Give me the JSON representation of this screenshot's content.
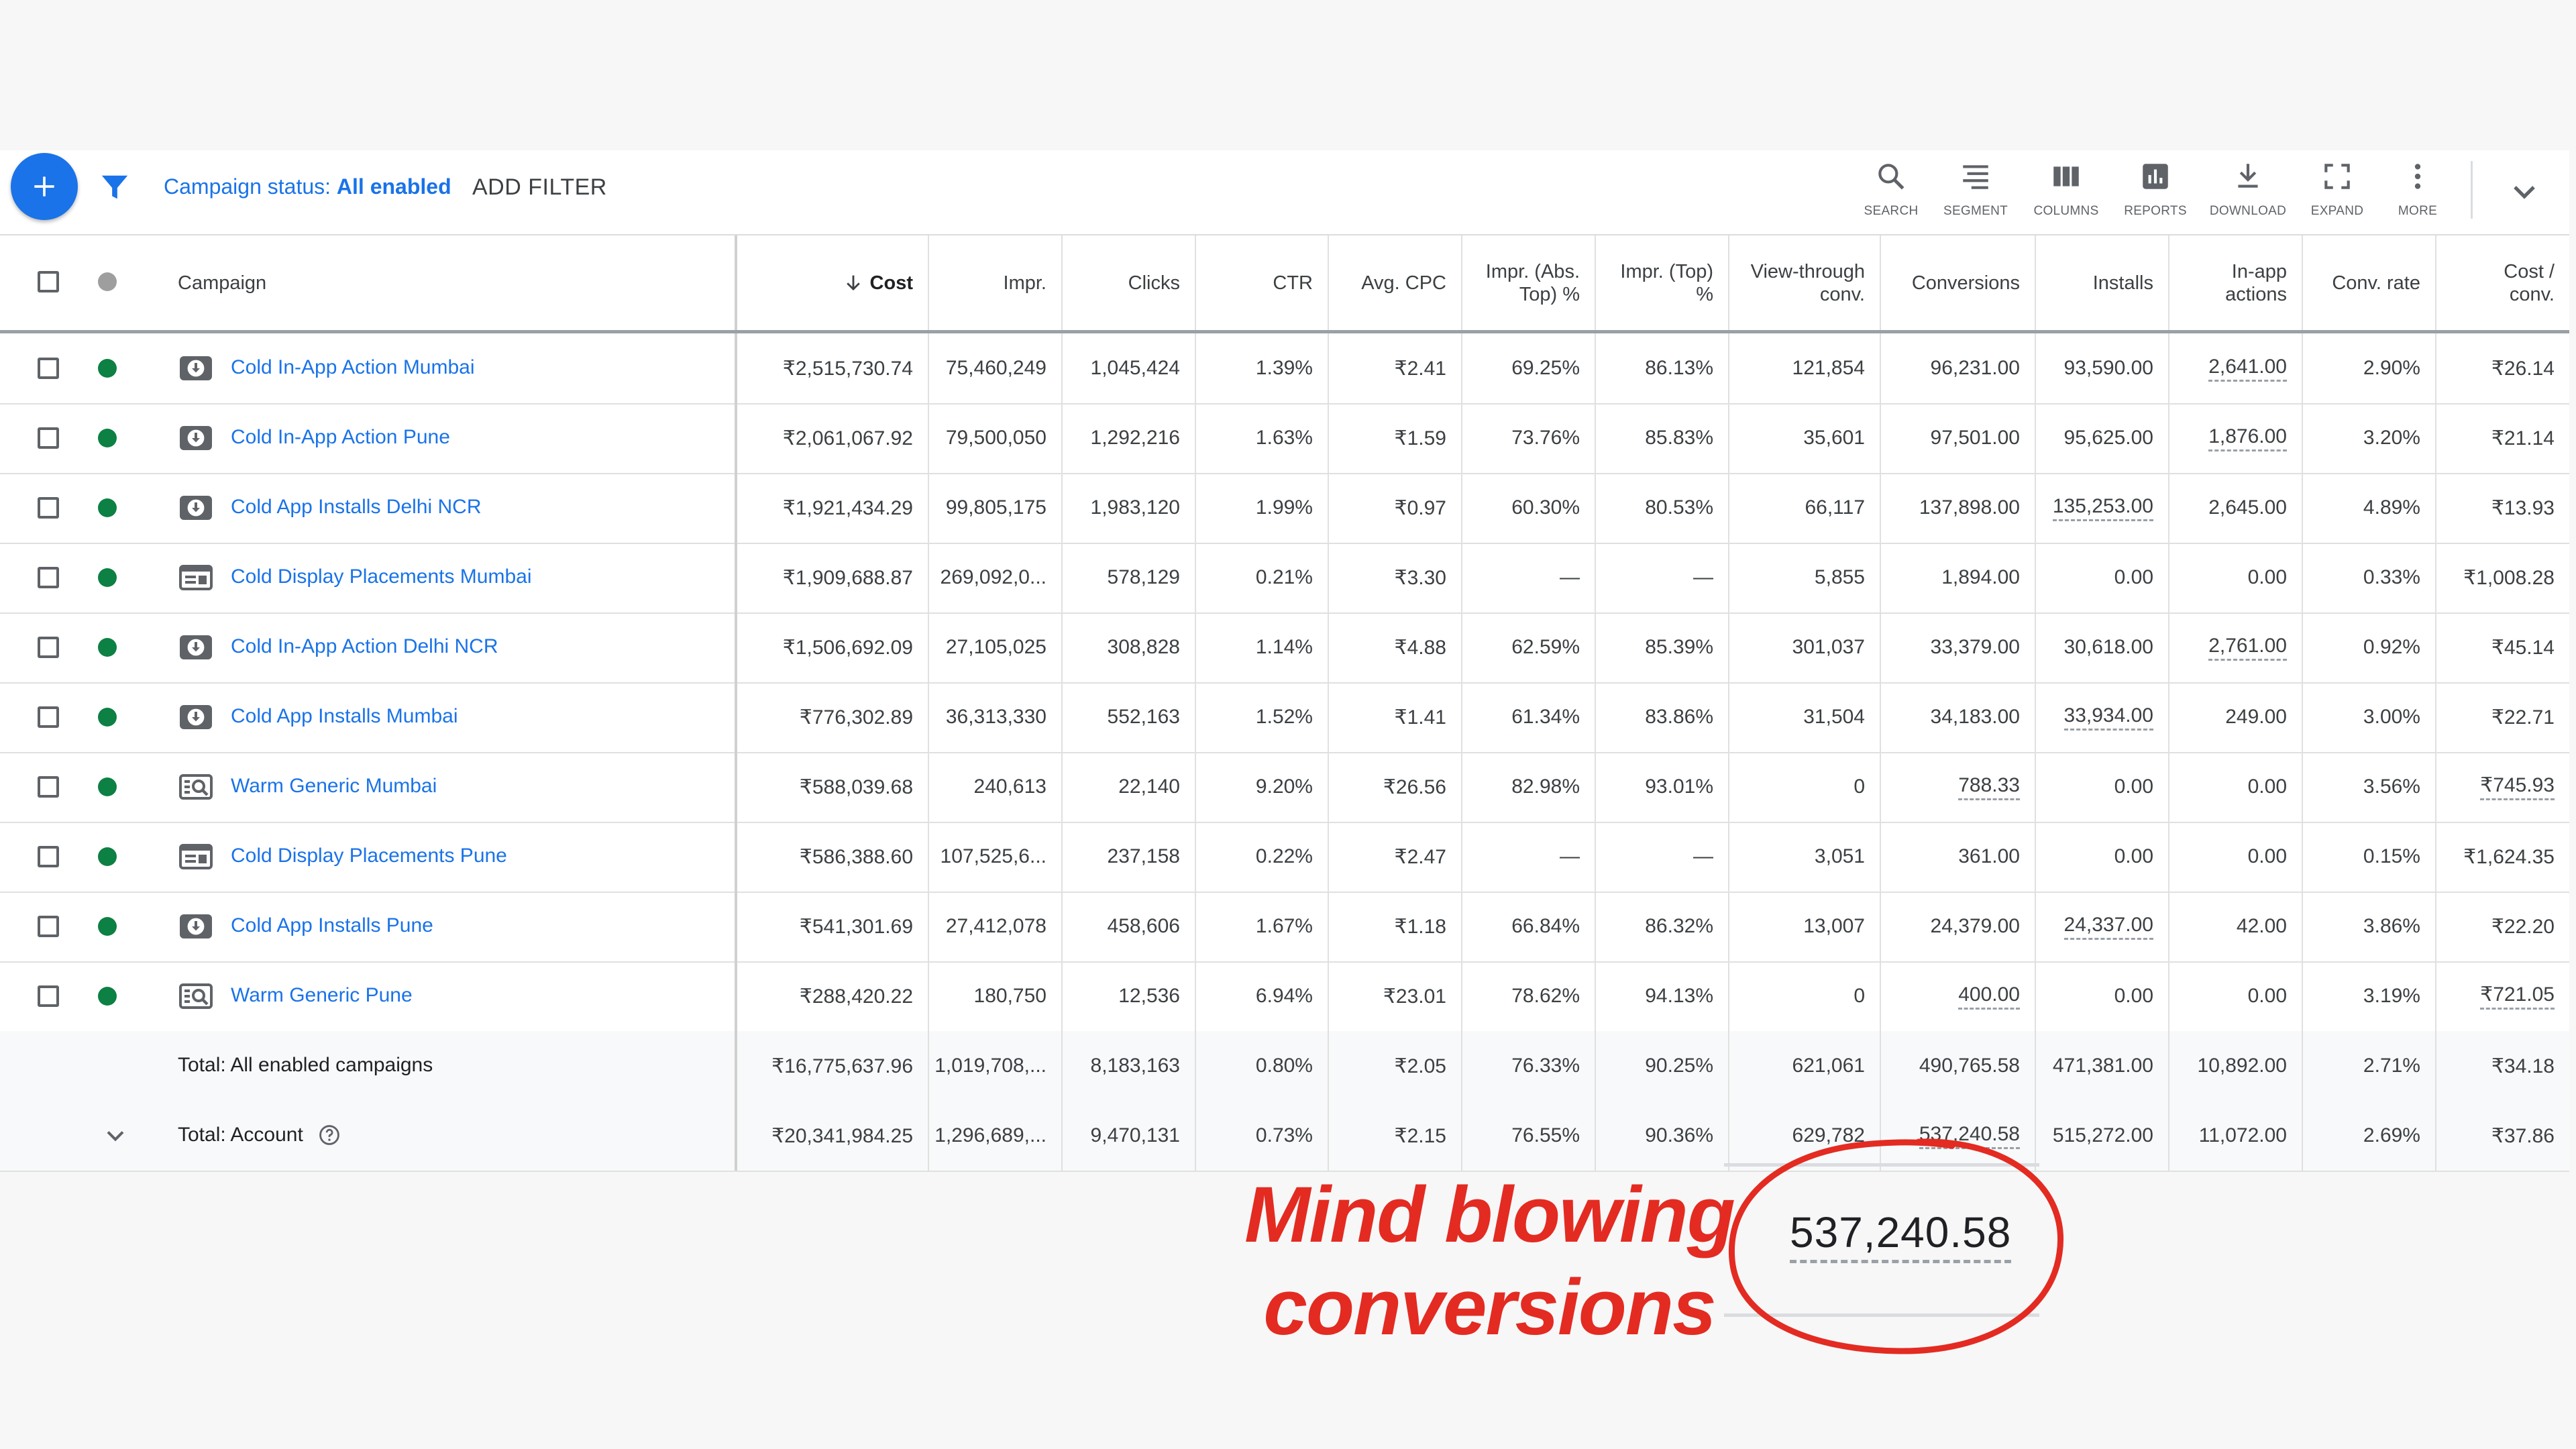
{
  "toolbar": {
    "filter_label": "Campaign status:",
    "filter_value": "All enabled",
    "add_filter": "ADD FILTER",
    "tools": [
      {
        "label": "SEARCH",
        "icon": "search-icon"
      },
      {
        "label": "SEGMENT",
        "icon": "segment-icon"
      },
      {
        "label": "COLUMNS",
        "icon": "columns-icon"
      },
      {
        "label": "REPORTS",
        "icon": "reports-icon"
      },
      {
        "label": "DOWNLOAD",
        "icon": "download-icon"
      },
      {
        "label": "EXPAND",
        "icon": "expand-icon"
      },
      {
        "label": "MORE",
        "icon": "more-vert-icon"
      }
    ]
  },
  "columns": {
    "campaign": "Campaign",
    "cost": "Cost",
    "impr": "Impr.",
    "clicks": "Clicks",
    "ctr": "CTR",
    "avg_cpc": "Avg. CPC",
    "impr_abs_top_1": "Impr. (Abs.",
    "impr_abs_top_2": "Top) %",
    "impr_top_1": "Impr. (Top)",
    "impr_top_2": "%",
    "view_through_1": "View-through",
    "view_through_2": "conv.",
    "conversions": "Conversions",
    "installs": "Installs",
    "inapp_1": "In-app",
    "inapp_2": "actions",
    "conv_rate": "Conv. rate",
    "cost_conv_1": "Cost /",
    "cost_conv_2": "conv."
  },
  "rows": [
    {
      "campaign": "Cold In-App Action Mumbai",
      "type": "app",
      "cost": "₹2,515,730.74",
      "impr": "75,460,249",
      "clicks": "1,045,424",
      "ctr": "1.39%",
      "avg_cpc": "₹2.41",
      "abs_top": "69.25%",
      "top": "86.13%",
      "view_through": "121,854",
      "conversions": "96,231.00",
      "installs": "93,590.00",
      "inapp": "2,641.00",
      "conv_rate": "2.90%",
      "cost_conv": "₹26.14"
    },
    {
      "campaign": "Cold In-App Action Pune",
      "type": "app",
      "cost": "₹2,061,067.92",
      "impr": "79,500,050",
      "clicks": "1,292,216",
      "ctr": "1.63%",
      "avg_cpc": "₹1.59",
      "abs_top": "73.76%",
      "top": "85.83%",
      "view_through": "35,601",
      "conversions": "97,501.00",
      "installs": "95,625.00",
      "inapp": "1,876.00",
      "conv_rate": "3.20%",
      "cost_conv": "₹21.14"
    },
    {
      "campaign": "Cold App Installs Delhi NCR",
      "type": "app",
      "cost": "₹1,921,434.29",
      "impr": "99,805,175",
      "clicks": "1,983,120",
      "ctr": "1.99%",
      "avg_cpc": "₹0.97",
      "abs_top": "60.30%",
      "top": "80.53%",
      "view_through": "66,117",
      "conversions": "137,898.00",
      "installs": "135,253.00",
      "inapp": "2,645.00",
      "conv_rate": "4.89%",
      "cost_conv": "₹13.93"
    },
    {
      "campaign": "Cold Display Placements Mumbai",
      "type": "display",
      "cost": "₹1,909,688.87",
      "impr": "269,092,0...",
      "clicks": "578,129",
      "ctr": "0.21%",
      "avg_cpc": "₹3.30",
      "abs_top": "—",
      "top": "—",
      "view_through": "5,855",
      "conversions": "1,894.00",
      "installs": "0.00",
      "inapp": "0.00",
      "conv_rate": "0.33%",
      "cost_conv": "₹1,008.28"
    },
    {
      "campaign": "Cold In-App Action Delhi NCR",
      "type": "app",
      "cost": "₹1,506,692.09",
      "impr": "27,105,025",
      "clicks": "308,828",
      "ctr": "1.14%",
      "avg_cpc": "₹4.88",
      "abs_top": "62.59%",
      "top": "85.39%",
      "view_through": "301,037",
      "conversions": "33,379.00",
      "installs": "30,618.00",
      "inapp": "2,761.00",
      "conv_rate": "0.92%",
      "cost_conv": "₹45.14"
    },
    {
      "campaign": "Cold App Installs Mumbai",
      "type": "app",
      "cost": "₹776,302.89",
      "impr": "36,313,330",
      "clicks": "552,163",
      "ctr": "1.52%",
      "avg_cpc": "₹1.41",
      "abs_top": "61.34%",
      "top": "83.86%",
      "view_through": "31,504",
      "conversions": "34,183.00",
      "installs": "33,934.00",
      "inapp": "249.00",
      "conv_rate": "3.00%",
      "cost_conv": "₹22.71"
    },
    {
      "campaign": "Warm Generic Mumbai",
      "type": "search",
      "cost": "₹588,039.68",
      "impr": "240,613",
      "clicks": "22,140",
      "ctr": "9.20%",
      "avg_cpc": "₹26.56",
      "abs_top": "82.98%",
      "top": "93.01%",
      "view_through": "0",
      "conversions": "788.33",
      "installs": "0.00",
      "inapp": "0.00",
      "conv_rate": "3.56%",
      "cost_conv": "₹745.93"
    },
    {
      "campaign": "Cold Display Placements Pune",
      "type": "display",
      "cost": "₹586,388.60",
      "impr": "107,525,6...",
      "clicks": "237,158",
      "ctr": "0.22%",
      "avg_cpc": "₹2.47",
      "abs_top": "—",
      "top": "—",
      "view_through": "3,051",
      "conversions": "361.00",
      "installs": "0.00",
      "inapp": "0.00",
      "conv_rate": "0.15%",
      "cost_conv": "₹1,624.35"
    },
    {
      "campaign": "Cold App Installs Pune",
      "type": "app",
      "cost": "₹541,301.69",
      "impr": "27,412,078",
      "clicks": "458,606",
      "ctr": "1.67%",
      "avg_cpc": "₹1.18",
      "abs_top": "66.84%",
      "top": "86.32%",
      "view_through": "13,007",
      "conversions": "24,379.00",
      "installs": "24,337.00",
      "inapp": "42.00",
      "conv_rate": "3.86%",
      "cost_conv": "₹22.20"
    },
    {
      "campaign": "Warm Generic Pune",
      "type": "search",
      "cost": "₹288,420.22",
      "impr": "180,750",
      "clicks": "12,536",
      "ctr": "6.94%",
      "avg_cpc": "₹23.01",
      "abs_top": "78.62%",
      "top": "94.13%",
      "view_through": "0",
      "conversions": "400.00",
      "installs": "0.00",
      "inapp": "0.00",
      "conv_rate": "3.19%",
      "cost_conv": "₹721.05"
    }
  ],
  "totals": [
    {
      "label": "Total: All enabled campaigns",
      "cost": "₹16,775,637.96",
      "impr": "1,019,708,...",
      "clicks": "8,183,163",
      "ctr": "0.80%",
      "avg_cpc": "₹2.05",
      "abs_top": "76.33%",
      "top": "90.25%",
      "view_through": "621,061",
      "conversions": "490,765.58",
      "installs": "471,381.00",
      "inapp": "10,892.00",
      "conv_rate": "2.71%",
      "cost_conv": "₹34.18"
    },
    {
      "label": "Total: Account",
      "cost": "₹20,341,984.25",
      "impr": "1,296,689,...",
      "clicks": "9,470,131",
      "ctr": "0.73%",
      "avg_cpc": "₹2.15",
      "abs_top": "76.55%",
      "top": "90.36%",
      "view_through": "629,782",
      "conversions": "537,240.58",
      "installs": "515,272.00",
      "inapp": "11,072.00",
      "conv_rate": "2.69%",
      "cost_conv": "₹37.86"
    }
  ],
  "annotation": {
    "line1": "Mind blowing",
    "line2": "conversions",
    "zoom_value": "537,240.58"
  },
  "colors": {
    "link": "#1a73e8",
    "enabled_dot": "#0d8043",
    "annotation": "#e32b22"
  }
}
